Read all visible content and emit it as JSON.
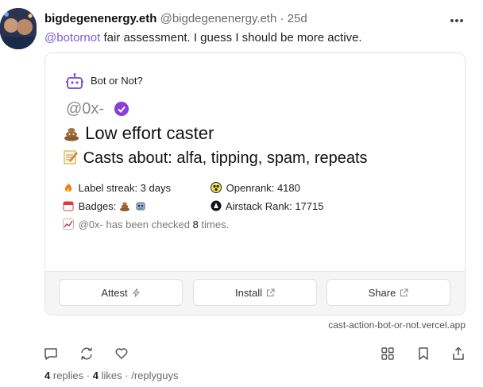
{
  "post": {
    "display_name": "bigdegenenergy.eth",
    "username": "@bigdegenenergy.eth",
    "separator": "·",
    "time": "25d",
    "mention": "@botornot",
    "text": " fair assessment. I guess I should be more active.",
    "more_icon": "more-horizontal-icon"
  },
  "frame": {
    "title": "Bot or Not?",
    "user": "@0x-",
    "verdict": "Low effort caster",
    "topics": "Casts about: alfa, tipping, spam, repeats",
    "label_streak": "Label streak: 3 days",
    "openrank": "Openrank: 4180",
    "badges": "Badges:",
    "airstack_rank": "Airstack Rank: 17715",
    "checked_prefix": "@0x- has been checked",
    "checked_count": "8",
    "checked_suffix": "times.",
    "buttons": [
      {
        "label": "Attest",
        "icon": "lightning-icon"
      },
      {
        "label": "Install",
        "icon": "external-link-icon"
      },
      {
        "label": "Share",
        "icon": "external-link-icon"
      }
    ],
    "domain": "cast-action-bot-or-not.vercel.app"
  },
  "actions": [
    "reply-icon",
    "recast-icon",
    "like-icon",
    "grid-icon",
    "bookmark-icon",
    "share-icon"
  ],
  "footer": {
    "replies_count": "4",
    "replies_label": "replies",
    "likes_count": "4",
    "likes_label": "likes",
    "separator": "·",
    "channel": "/replyguys"
  },
  "colors": {
    "accent": "#7c5cd6",
    "verified": "#8b3fd8"
  }
}
